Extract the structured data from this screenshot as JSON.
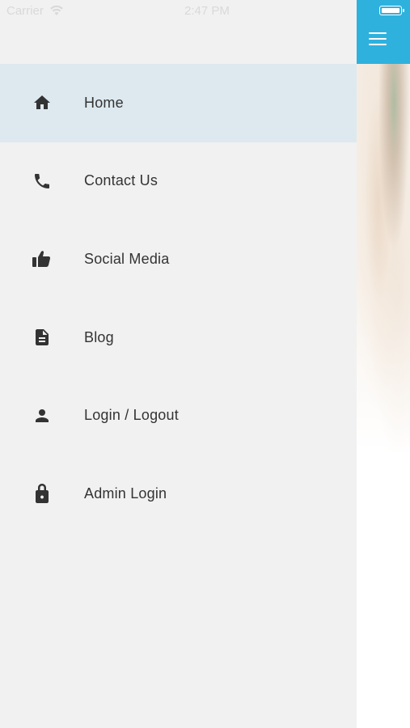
{
  "status_bar": {
    "carrier": "Carrier",
    "time": "2:47 PM"
  },
  "menu": {
    "items": [
      {
        "label": "Home",
        "icon": "home-icon",
        "active": true
      },
      {
        "label": "Contact Us",
        "icon": "phone-icon",
        "active": false
      },
      {
        "label": "Social Media",
        "icon": "thumbs-up-icon",
        "active": false
      },
      {
        "label": "Blog",
        "icon": "document-icon",
        "active": false
      },
      {
        "label": "Login / Logout",
        "icon": "person-icon",
        "active": false
      },
      {
        "label": "Admin Login",
        "icon": "lock-icon",
        "active": false
      }
    ]
  },
  "colors": {
    "appbar": "#2fb1de",
    "drawer_bg": "#f1f1f1",
    "active_item_bg": "#dde9ef",
    "text": "#333333",
    "icon": "#333333"
  }
}
